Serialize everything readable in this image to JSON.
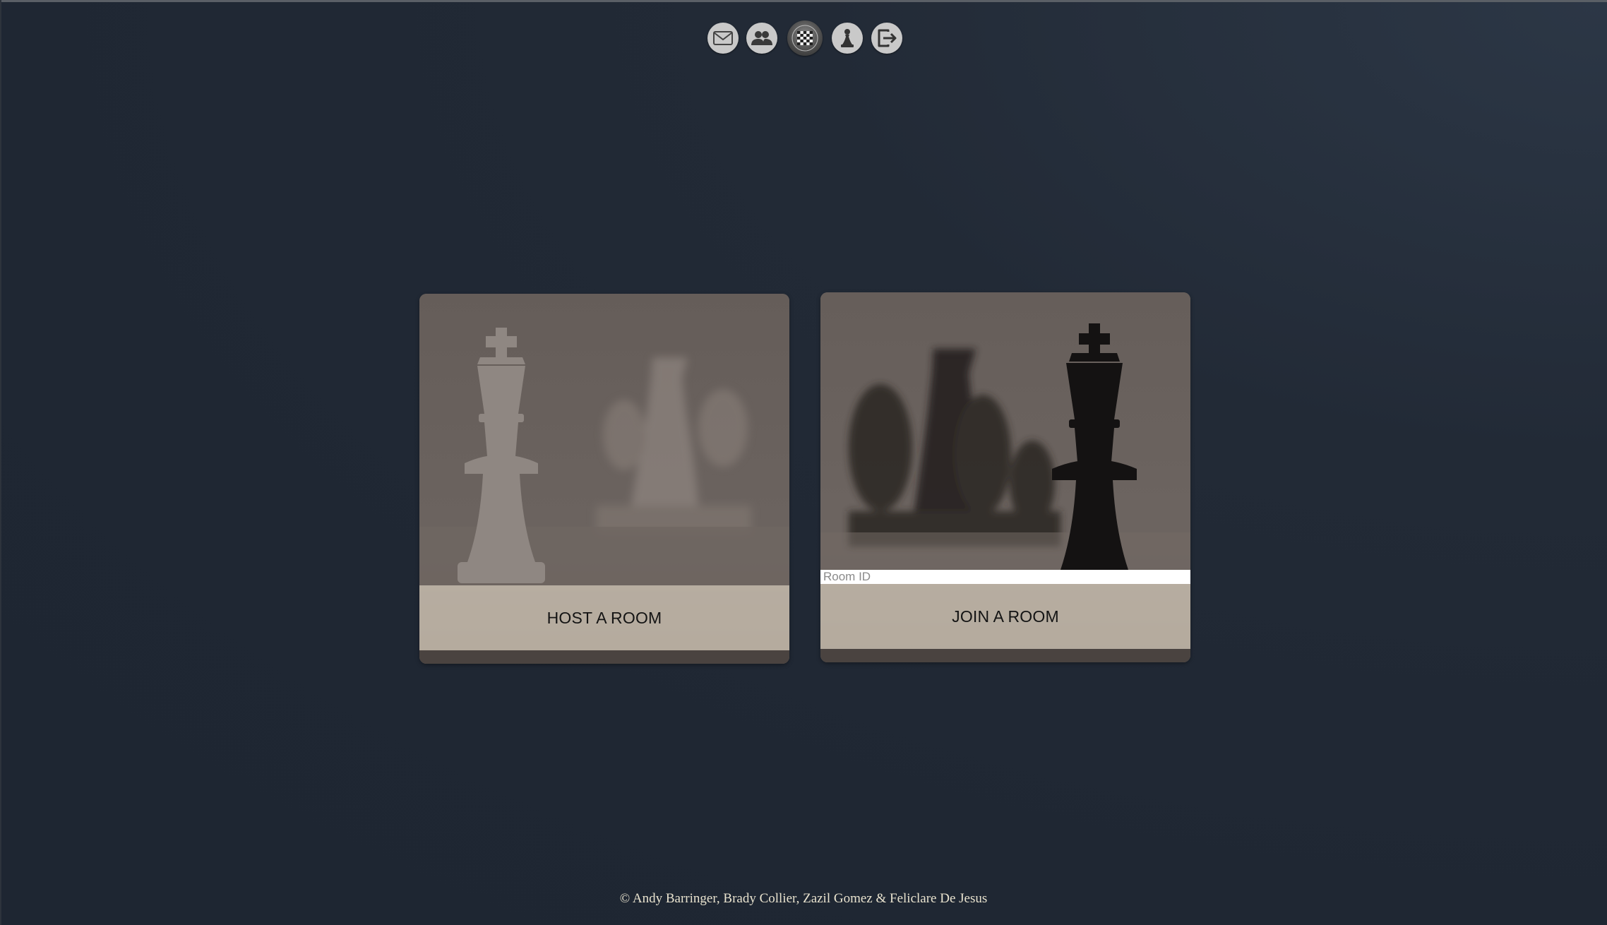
{
  "nav": {
    "items": [
      {
        "icon": "envelope-icon",
        "label": "Messages"
      },
      {
        "icon": "friends-icon",
        "label": "Friends"
      },
      {
        "icon": "chessboard-icon",
        "label": "Play",
        "active": true
      },
      {
        "icon": "pawn-icon",
        "label": "Profile"
      },
      {
        "icon": "logout-icon",
        "label": "Logout"
      }
    ]
  },
  "host_card": {
    "label": "HOST A ROOM",
    "image": "white-king-icon"
  },
  "join_card": {
    "label": "JOIN A ROOM",
    "image": "black-king-icon",
    "room_input": {
      "placeholder": "Room ID",
      "value": ""
    }
  },
  "footer": {
    "copyright": "© Andy Barringer, Brady Collier, Zazil Gomez & Feliclare De Jesus"
  },
  "colors": {
    "background": "#1f2733",
    "card_overlay": "#cdc3b4",
    "copyright_text": "#e9e3cf"
  }
}
